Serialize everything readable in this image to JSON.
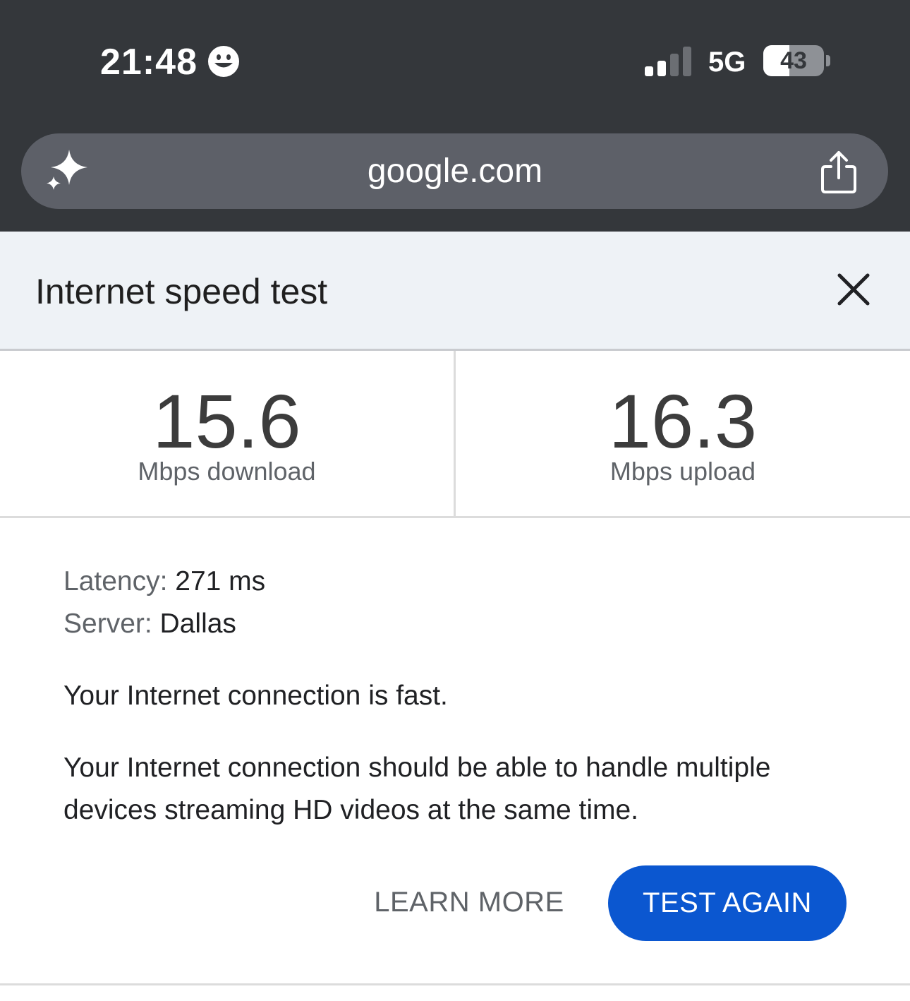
{
  "status_bar": {
    "time": "21:48",
    "network": "5G",
    "battery_percent": "43",
    "battery_level": 0.43,
    "signal_bars_active": 2,
    "signal_bars_total": 4
  },
  "browser": {
    "url": "google.com",
    "icons": [
      "sparkle-icon",
      "share-icon"
    ]
  },
  "speed_test": {
    "title": "Internet speed test",
    "download": {
      "value": "15.6",
      "label": "Mbps download"
    },
    "upload": {
      "value": "16.3",
      "label": "Mbps upload"
    },
    "latency": {
      "label": "Latency:",
      "value": "271 ms"
    },
    "server": {
      "label": "Server:",
      "value": "Dallas"
    },
    "summary": "Your Internet connection is fast.",
    "detail_line1": "Your Internet connection should be able to handle multiple",
    "detail_line2": "devices streaming HD videos at the same time.",
    "learn_more_label": "LEARN MORE",
    "test_again_label": "TEST AGAIN"
  },
  "colors": {
    "top_bar": "#34373b",
    "url_bar": "#5d6068",
    "header_bg": "#eef2f6",
    "primary_button": "#0b57d0"
  }
}
